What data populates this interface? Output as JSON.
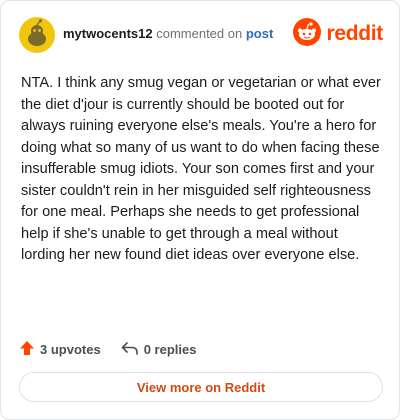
{
  "header": {
    "username": "mytwocents12",
    "commented_on": "commented on",
    "post_link": "post",
    "brand": "reddit",
    "avatar_icon": "snoo-avatar-icon",
    "logo_icon": "reddit-snoo-icon"
  },
  "comment": {
    "text": "NTA. I think any smug vegan or vegetarian or what ever the diet d'jour is currently should be booted out for always ruining everyone else's meals. You're a hero for doing what so many of us want to do when facing these insufferable smug idiots. Your son comes first and your sister couldn't rein in her misguided self righteousness for one meal. Perhaps she needs to get professional help if she's unable to get through a meal without lording her new found diet ideas over everyone else."
  },
  "actions": {
    "upvotes": "3 upvotes",
    "replies": "0 replies",
    "upvote_icon": "upvote-arrow-icon",
    "reply_icon": "reply-arrow-icon"
  },
  "footer": {
    "view_more": "View more on Reddit"
  },
  "colors": {
    "accent": "#ff4500",
    "link": "#2a6fb0",
    "view_more": "#d34a12"
  }
}
